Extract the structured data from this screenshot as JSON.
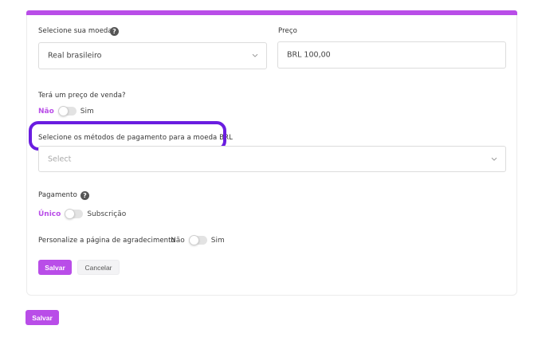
{
  "form": {
    "currency_label": "Selecione sua moeda",
    "currency_value": "Real brasileiro",
    "price_label": "Preço",
    "price_value": "BRL 100,00",
    "sale_price_question": "Terá um preço de venda?",
    "sale_price_no": "Não",
    "sale_price_yes": "Sim",
    "payment_methods_label": "Selecione os métodos de pagamento para a moeda BRL",
    "payment_methods_placeholder": "Select",
    "payment_label": "Pagamento",
    "payment_single": "Único",
    "payment_subscription": "Subscrição",
    "thankyou_label": "Personalize a página de agradecimento",
    "thankyou_no": "Não",
    "thankyou_yes": "Sim",
    "save_label": "Salvar",
    "cancel_label": "Cancelar"
  },
  "footer": {
    "save_label": "Salvar"
  },
  "colors": {
    "accent": "#b94de8",
    "highlight": "#6a1de0"
  },
  "icons": {
    "help": "question-circle-icon",
    "chevron": "chevron-down-icon"
  }
}
